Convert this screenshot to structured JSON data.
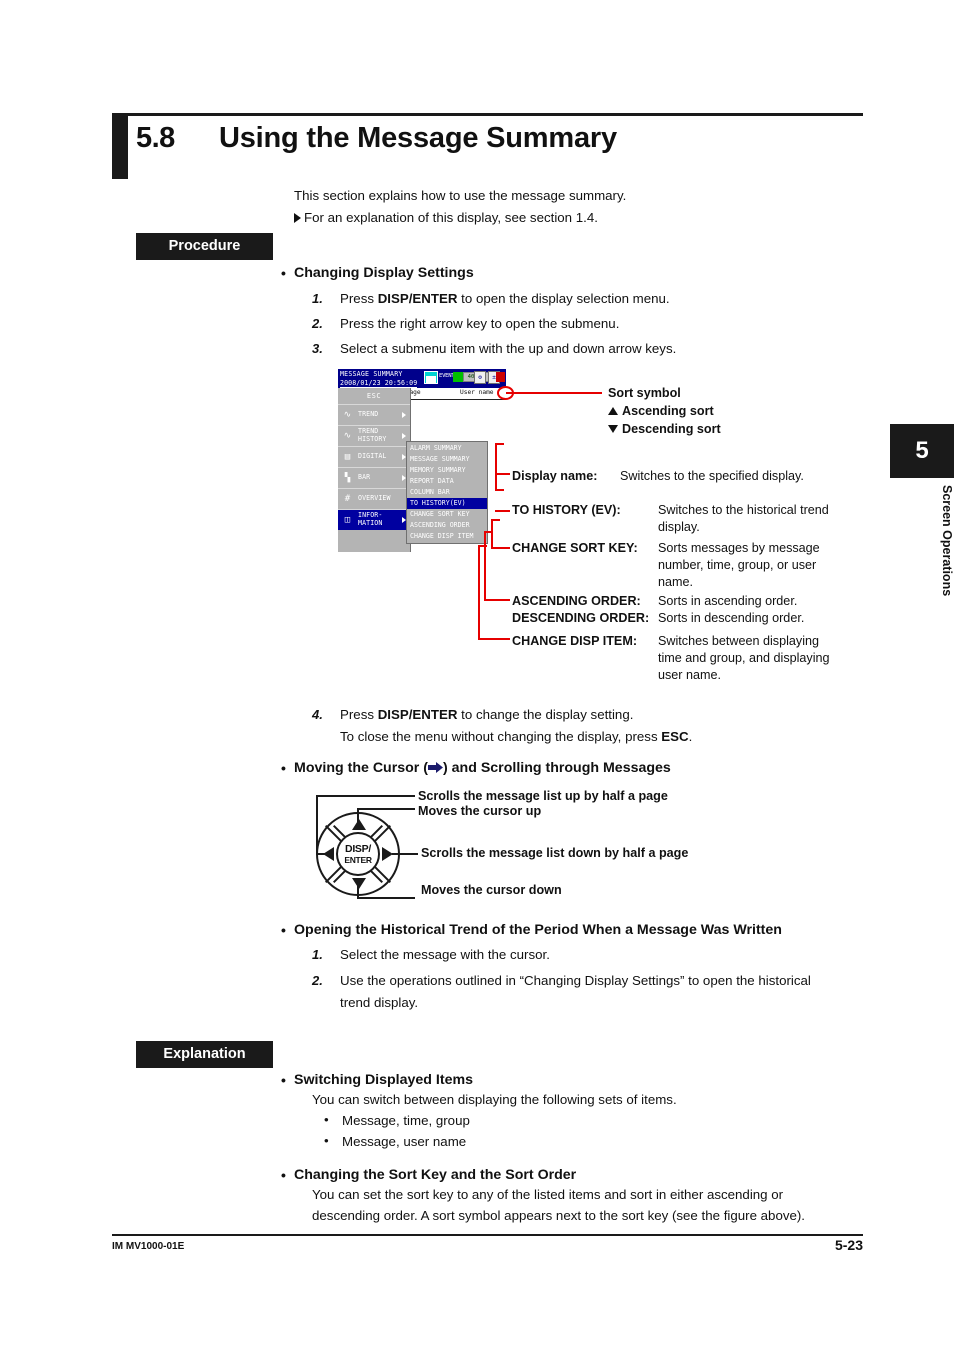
{
  "page": {
    "section_number": "5.8",
    "section_title": "Using the Message Summary",
    "intro_line1": "This section explains how to use the message summary.",
    "intro_line2": "For an explanation of this display, see section 1.4.",
    "procedure_chip": "Procedure",
    "explanation_chip": "Explanation"
  },
  "procedure": {
    "heading_changing_display": "Changing Display Settings",
    "step1_num": "1.",
    "step1_a": "Press ",
    "step1_b": "DISP/ENTER",
    "step1_c": " to open the display selection menu.",
    "step2_num": "2.",
    "step2_text": "Press the right arrow key to open the submenu.",
    "step3_num": "3.",
    "step3_text": "Select a submenu item with the up and down arrow keys.",
    "step4_num": "4.",
    "step4_a": "Press ",
    "step4_b": "DISP/ENTER",
    "step4_c": " to change the display setting.",
    "step4_line2_a": "To close the menu without changing the display, press ",
    "step4_line2_b": "ESC",
    "step4_line2_c": ".",
    "heading_moving_cursor_a": "Moving the Cursor (",
    "heading_moving_cursor_b": ") and Scrolling through Messages",
    "heading_opening_trend": "Opening the Historical Trend of the Period When a Message Was Written",
    "trend_step1_num": "1.",
    "trend_step1_text": "Select the message with the cursor.",
    "trend_step2_num": "2.",
    "trend_step2_line1": "Use the operations outlined in “Changing Display Settings” to open the historical",
    "trend_step2_line2": "trend display."
  },
  "device_screen": {
    "title": "MESSAGE SUMMARY",
    "datetime": "2008/01/23 20:56:09",
    "media_label": "EVENT",
    "time_remaining": "40min",
    "icon_gear": "⚙",
    "icon_scale": "±",
    "column_header_left": "ssage",
    "column_header_right": "User name",
    "esc_label": "ESC",
    "menu_items": [
      {
        "label": "TREND",
        "icon": "trend-icon",
        "has_arrow": true,
        "selected": false
      },
      {
        "label": "TREND\nHISTORY",
        "icon": "trend-history-icon",
        "has_arrow": true,
        "selected": false
      },
      {
        "label": "DIGITAL",
        "icon": "digital-icon",
        "has_arrow": true,
        "selected": false
      },
      {
        "label": "BAR",
        "icon": "bar-icon",
        "has_arrow": true,
        "selected": false
      },
      {
        "label": "OVERVIEW",
        "icon": "overview-icon",
        "has_arrow": false,
        "selected": false
      },
      {
        "label": "INFOR-\nMATION",
        "icon": "information-icon",
        "has_arrow": true,
        "selected": true
      }
    ],
    "submenu_items": [
      {
        "label": "ALARM SUMMARY",
        "selected": false
      },
      {
        "label": "MESSAGE SUMMARY",
        "selected": false
      },
      {
        "label": "MEMORY SUMMARY",
        "selected": false
      },
      {
        "label": "REPORT DATA",
        "selected": false
      },
      {
        "label": "COLUMN BAR",
        "selected": false
      },
      {
        "label": "TO HISTORY(EV)",
        "selected": true
      },
      {
        "label": "CHANGE SORT KEY",
        "selected": false
      },
      {
        "label": "ASCENDING ORDER",
        "selected": false
      },
      {
        "label": "CHANGE DISP ITEM",
        "selected": false
      }
    ]
  },
  "callouts": {
    "sort_symbol": "Sort symbol",
    "ascending_sort": "Ascending sort",
    "descending_sort": "Descending sort",
    "display_name_label": "Display name:",
    "display_name_desc": "Switches to the specified display.",
    "to_history_label": "TO HISTORY (EV):",
    "to_history_desc1": "Switches to the historical trend",
    "to_history_desc2": "display.",
    "change_sort_key_label": "CHANGE SORT KEY:",
    "change_sort_key_desc1": "Sorts messages by message",
    "change_sort_key_desc2": "number, time, group, or user",
    "change_sort_key_desc3": "name.",
    "ascending_order_label": "ASCENDING ORDER:",
    "ascending_order_desc": "Sorts in ascending order.",
    "descending_order_label": "DESCENDING ORDER:",
    "descending_order_desc": "Sorts in descending order.",
    "change_disp_item_label": "CHANGE DISP ITEM:",
    "change_disp_item_desc1": "Switches between displaying",
    "change_disp_item_desc2": "time and group, and displaying",
    "change_disp_item_desc3": "user name."
  },
  "keypad": {
    "center_line1": "DISP/",
    "center_line2": "ENTER",
    "label_up_scroll": "Scrolls the message list up by half a page",
    "label_cursor_up": "Moves the cursor up",
    "label_down_scroll": "Scrolls the message list down by half a page",
    "label_cursor_down": "Moves the cursor down"
  },
  "explanation": {
    "heading_switching": "Switching Displayed Items",
    "switching_intro": "You can switch between displaying the following sets of items.",
    "switching_items": [
      "Message, time, group",
      "Message, user name"
    ],
    "heading_sort": "Changing the Sort Key and the Sort Order",
    "sort_line1": "You can set the sort key to any of the listed items and sort in either ascending or",
    "sort_line2": "descending order. A sort symbol appears next to the sort key (see the figure above)."
  },
  "side_tab": {
    "number": "5",
    "label": "Screen Operations"
  },
  "footer": {
    "doc_id": "IM MV1000-01E",
    "page_number": "5-23"
  },
  "colors": {
    "black": "#1a1a1a",
    "screen_blue": "#00008b",
    "select_blue": "#0000a0",
    "menu_gray": "#b4b4b4",
    "annotation_red": "#e60000"
  }
}
